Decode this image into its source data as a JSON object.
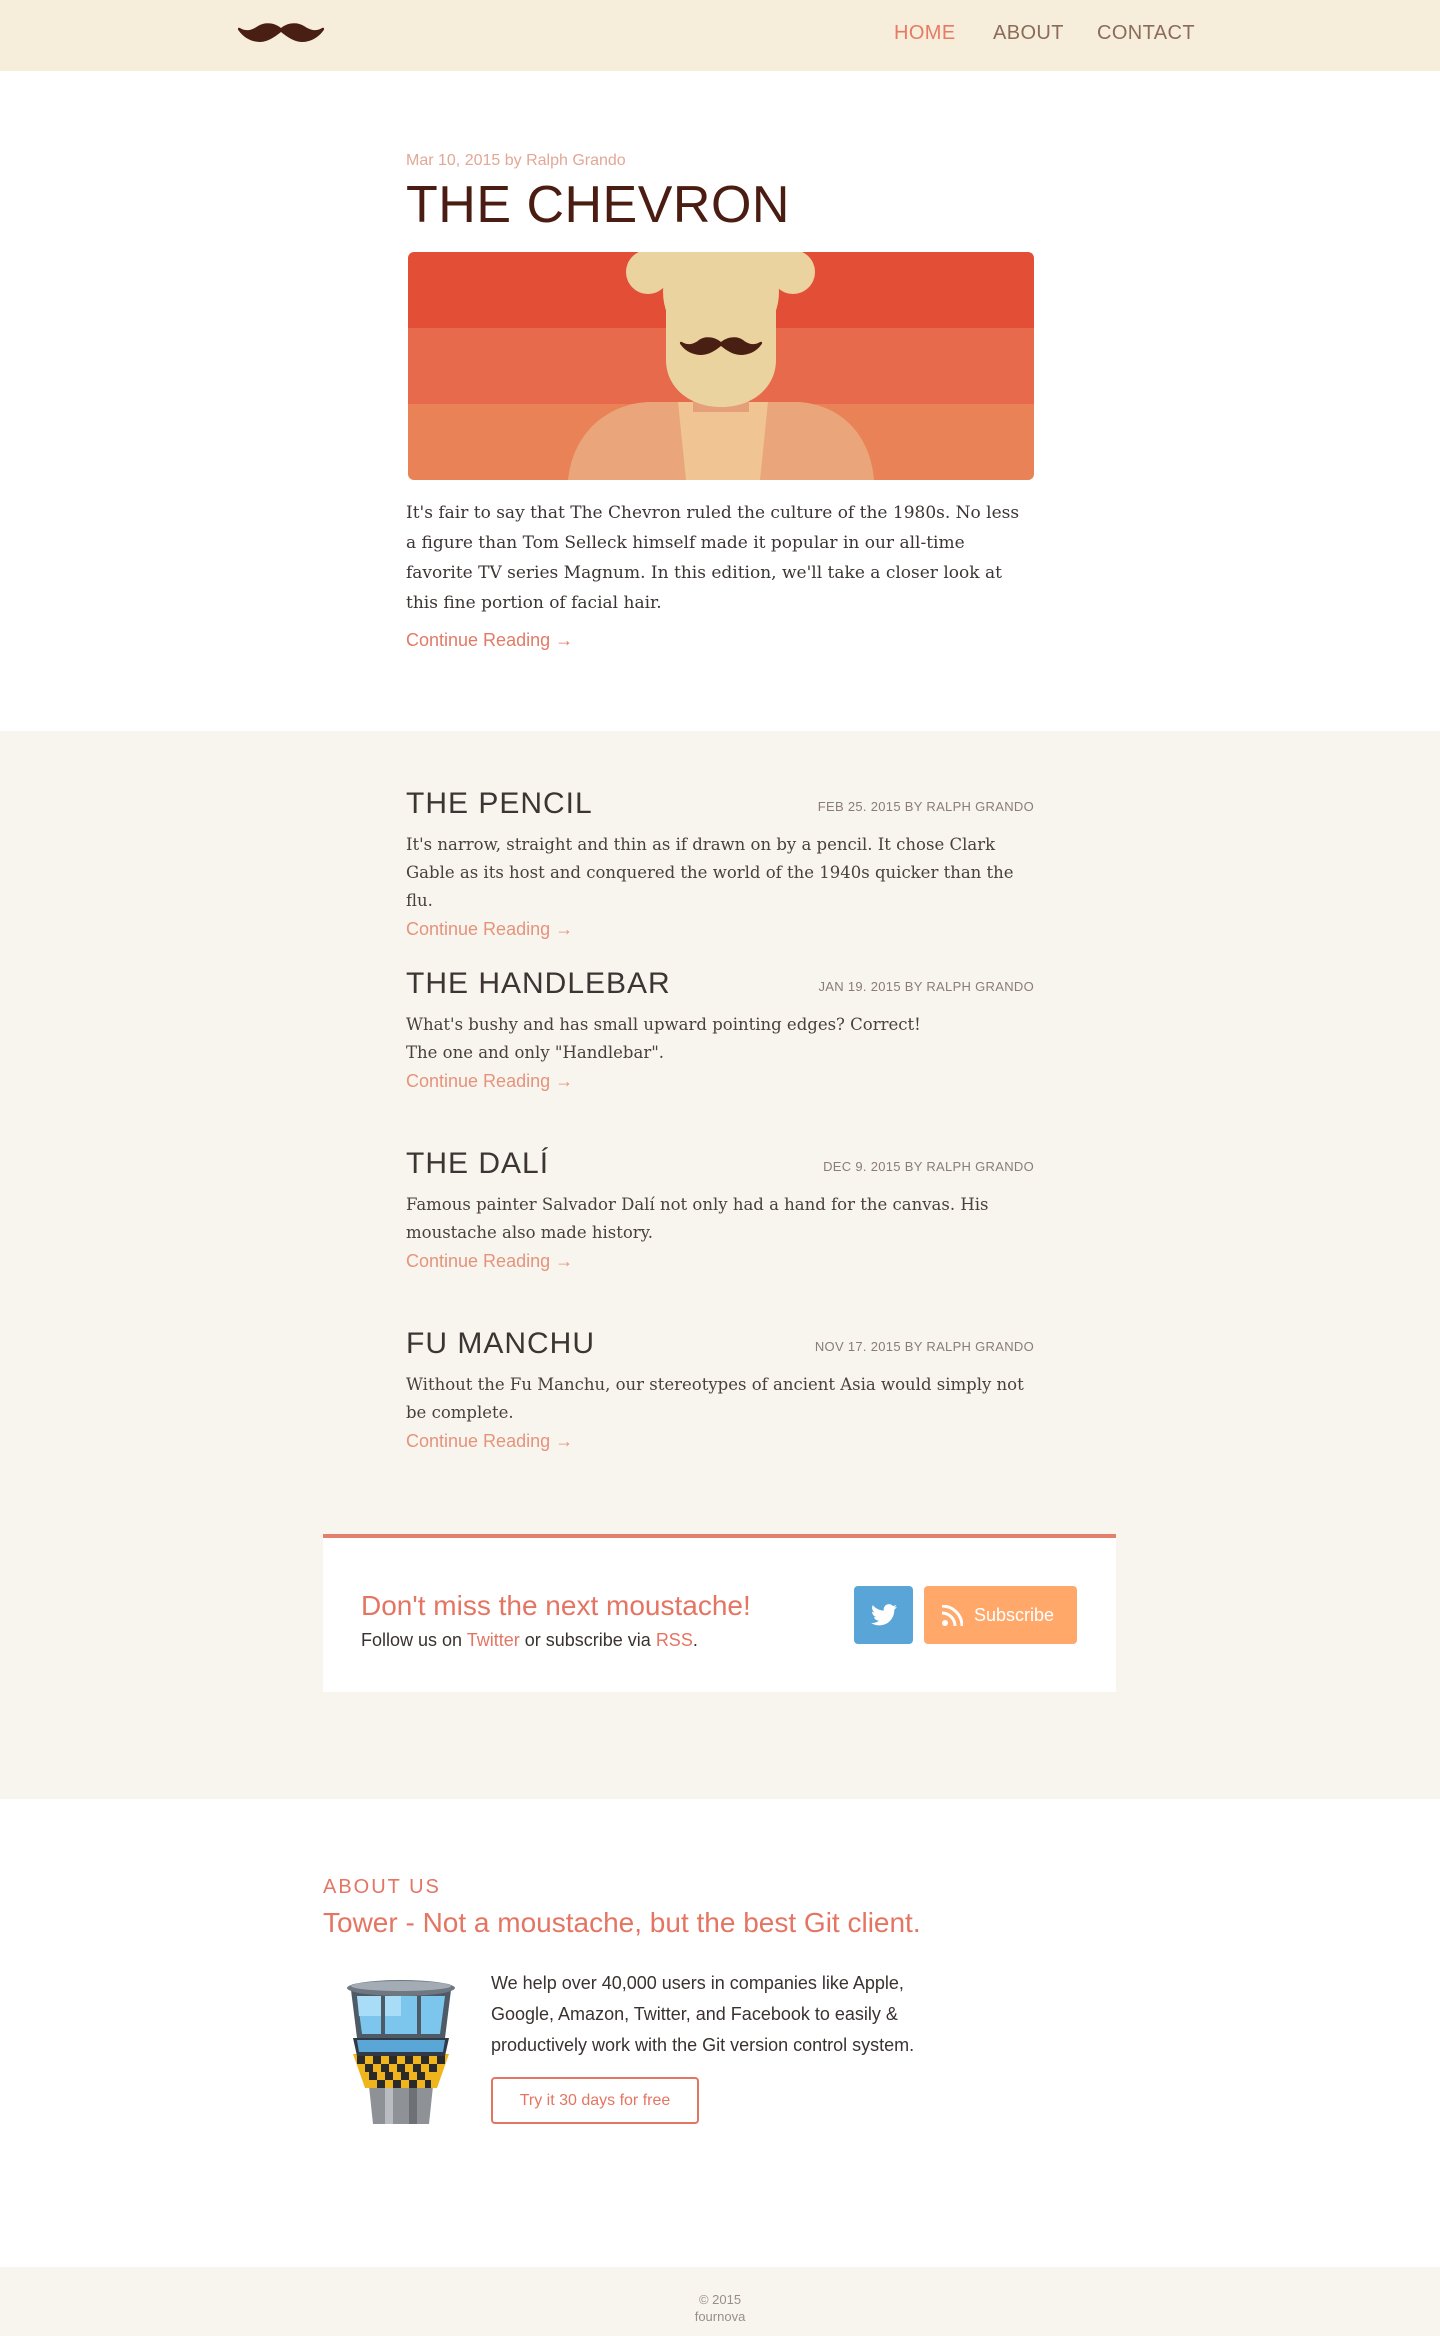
{
  "nav": {
    "logo_icon": "moustache-logo-icon",
    "items": [
      {
        "label": "HOME",
        "active": true
      },
      {
        "label": "ABOUT",
        "active": false
      },
      {
        "label": "CONTACT",
        "active": false
      }
    ]
  },
  "featured": {
    "meta": "Mar 10, 2015 by Ralph Grando",
    "title": "THE CHEVRON",
    "excerpt": "It's fair to say that The Chevron ruled the culture of the 1980s. No less a figure than Tom Selleck himself made it popular in our all-time favorite TV series Magnum. In this edition, we'll take a closer look at this fine portion of facial hair.",
    "continue": "Continue Reading →"
  },
  "posts": [
    {
      "title": "THE PENCIL",
      "meta": "FEB 25. 2015 BY RALPH GRANDO",
      "excerpt": "It's narrow, straight and thin as if drawn on by a pencil. It chose Clark Gable as its host and conquered the world of the 1940s quicker than the flu.",
      "continue": "Continue Reading →"
    },
    {
      "title": "THE HANDLEBAR",
      "meta": "JAN 19. 2015 BY RALPH GRANDO",
      "excerpt": "What's bushy and has small upward pointing edges? Correct!\nThe one and only \"Handlebar\".",
      "continue": "Continue Reading →"
    },
    {
      "title": "THE DALÍ",
      "meta": "DEC 9. 2015 BY RALPH GRANDO",
      "excerpt": "Famous painter Salvador Dalí not only had a hand for the canvas. His moustache also made history.",
      "continue": "Continue Reading →"
    },
    {
      "title": "FU MANCHU",
      "meta": "NOV 17. 2015 BY RALPH GRANDO",
      "excerpt": "Without the Fu Manchu, our stereotypes of ancient Asia would simply not be complete.",
      "continue": "Continue Reading →"
    }
  ],
  "newsletter": {
    "title": "Don't miss the next moustache!",
    "text_before": "Follow us on ",
    "twitter_link": "Twitter",
    "text_middle": " or subscribe via ",
    "rss_link": "RSS",
    "text_after": ".",
    "subscribe_label": "Subscribe",
    "colors": {
      "twitter": "#5aa5d8",
      "subscribe": "#ffa86a",
      "accent": "#e57563"
    }
  },
  "about": {
    "label": "ABOUT US",
    "tagline": "Tower - Not a moustache, but the best Git client.",
    "description": "We help over 40,000 users in companies like Apple, Google, Amazon, Twitter, and Facebook to easily & productively work with the Git version control system.",
    "cta": "Try it 30 days for free"
  },
  "footer": {
    "copyright": "© 2015",
    "name": "fournova"
  }
}
